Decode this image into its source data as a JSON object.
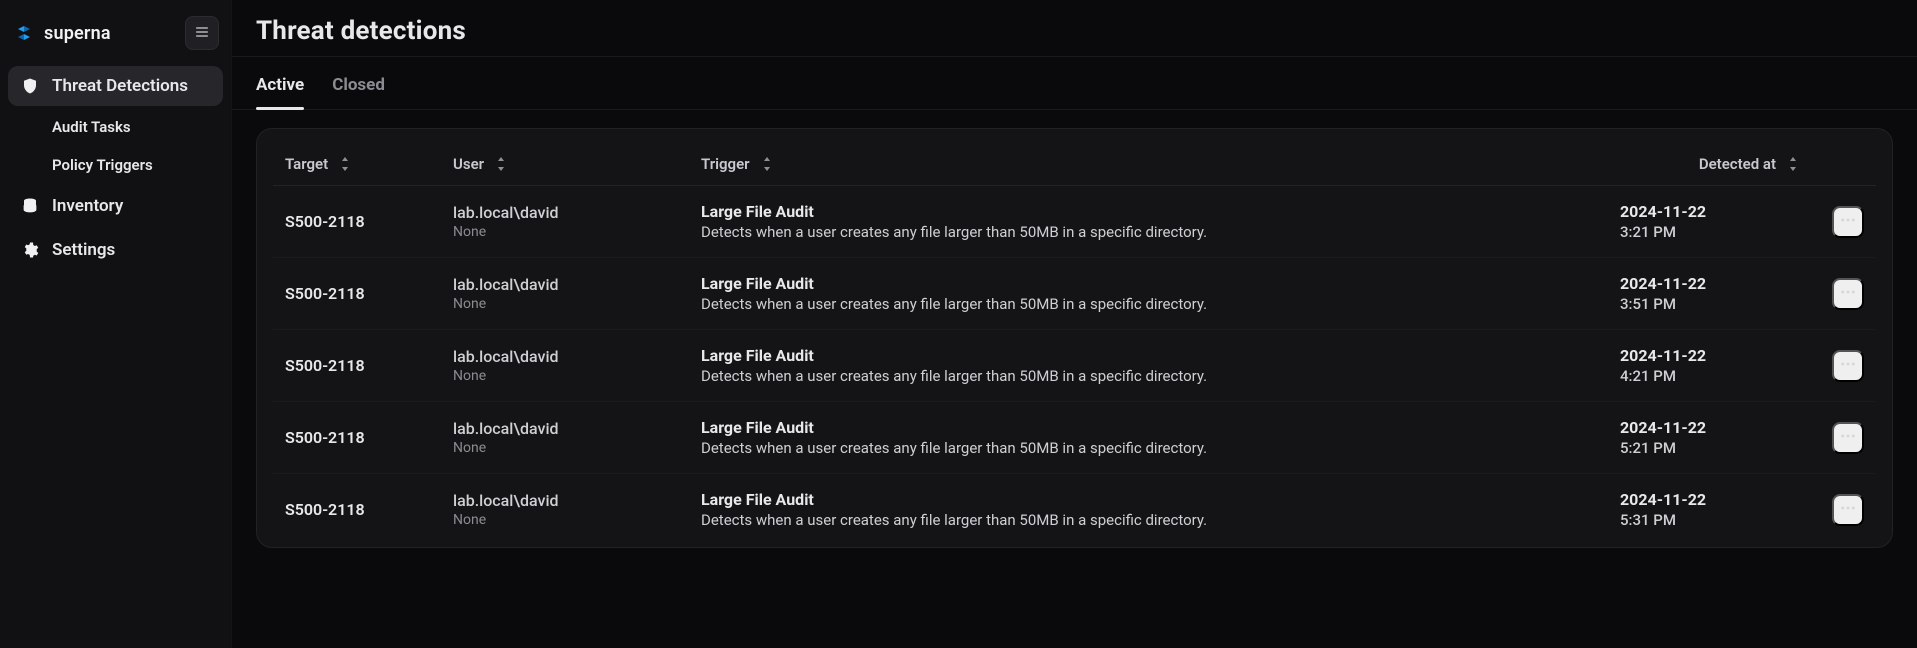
{
  "brand": {
    "name": "superna"
  },
  "sidebar": {
    "items": [
      {
        "label": "Threat Detections",
        "icon": "shield-icon",
        "active": true
      },
      {
        "label": "Audit Tasks",
        "sub": true
      },
      {
        "label": "Policy Triggers",
        "sub": true
      },
      {
        "label": "Inventory",
        "icon": "database-icon",
        "active": false
      },
      {
        "label": "Settings",
        "icon": "gear-icon",
        "active": false
      }
    ]
  },
  "header": {
    "title": "Threat detections"
  },
  "tabs": [
    {
      "label": "Active",
      "active": true
    },
    {
      "label": "Closed",
      "active": false
    }
  ],
  "columns": {
    "target": "Target",
    "user": "User",
    "trigger": "Trigger",
    "detected_at": "Detected at"
  },
  "rows": [
    {
      "target": "S500-2118",
      "user": "lab.local\\david",
      "user_sub": "None",
      "trigger_title": "Large File Audit",
      "trigger_desc": "Detects when a user creates any file larger than 50MB in a specific directory.",
      "detected_date": "2024-11-22",
      "detected_time": "3:21 PM"
    },
    {
      "target": "S500-2118",
      "user": "lab.local\\david",
      "user_sub": "None",
      "trigger_title": "Large File Audit",
      "trigger_desc": "Detects when a user creates any file larger than 50MB in a specific directory.",
      "detected_date": "2024-11-22",
      "detected_time": "3:51 PM"
    },
    {
      "target": "S500-2118",
      "user": "lab.local\\david",
      "user_sub": "None",
      "trigger_title": "Large File Audit",
      "trigger_desc": "Detects when a user creates any file larger than 50MB in a specific directory.",
      "detected_date": "2024-11-22",
      "detected_time": "4:21 PM"
    },
    {
      "target": "S500-2118",
      "user": "lab.local\\david",
      "user_sub": "None",
      "trigger_title": "Large File Audit",
      "trigger_desc": "Detects when a user creates any file larger than 50MB in a specific directory.",
      "detected_date": "2024-11-22",
      "detected_time": "5:21 PM"
    },
    {
      "target": "S500-2118",
      "user": "lab.local\\david",
      "user_sub": "None",
      "trigger_title": "Large File Audit",
      "trigger_desc": "Detects when a user creates any file larger than 50MB in a specific directory.",
      "detected_date": "2024-11-22",
      "detected_time": "5:31 PM"
    }
  ]
}
